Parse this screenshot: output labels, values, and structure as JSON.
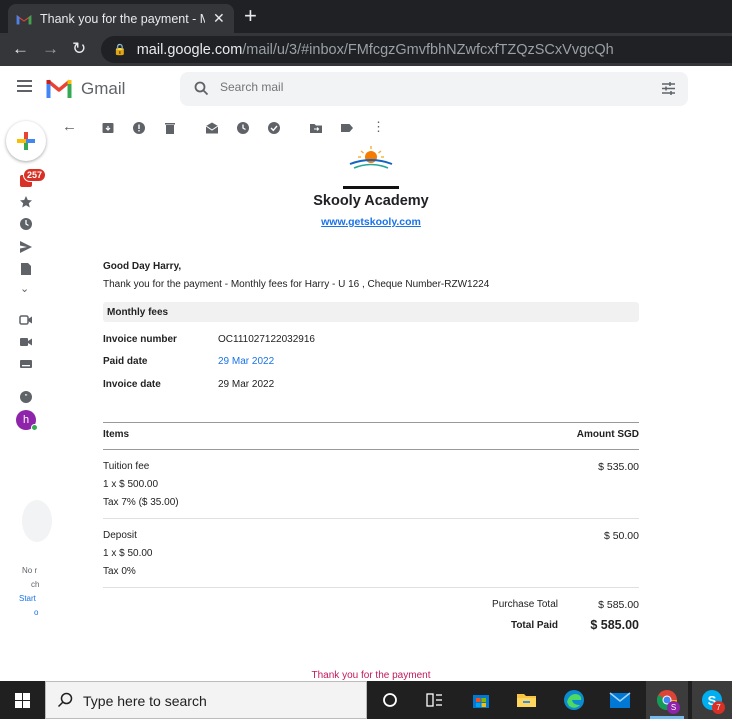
{
  "browser": {
    "tab_title": "Thank you for the payment - Mo",
    "url_host": "mail.google.com",
    "url_path": "/mail/u/3/#inbox/FMfcgzGmvfbhNZwfcxfTZQzSCxVvgcQh"
  },
  "gmail": {
    "brand": "Gmail",
    "search_placeholder": "Search mail",
    "unread_count": "257",
    "avatar_initial": "h",
    "side_text": [
      "No r",
      "ch",
      "Start",
      "o"
    ]
  },
  "email": {
    "company": "Skooly Academy",
    "website": "www.getskooly.com",
    "greeting": "Good Day Harry,",
    "message": "Thank you for the payment - Monthly fees for Harry - U 16 , Cheque Number-RZW1224",
    "section": "Monthly fees",
    "fields": [
      {
        "label": "Invoice number",
        "value": "OC111027122032916"
      },
      {
        "label": "Paid date",
        "value": "29 Mar 2022"
      },
      {
        "label": "Invoice date",
        "value": "29 Mar 2022"
      }
    ],
    "items_header": "Items",
    "amount_header": "Amount SGD",
    "items": [
      {
        "name": "Tuition fee",
        "qty": "1 x $ 500.00",
        "tax": "Tax 7% ($ 35.00)",
        "amount": "$ 535.00"
      },
      {
        "name": "Deposit",
        "qty": "1 x $ 50.00",
        "tax": "Tax 0%",
        "amount": "$ 50.00"
      }
    ],
    "purchase_total_label": "Purchase Total",
    "purchase_total": "$ 585.00",
    "total_paid_label": "Total Paid",
    "total_paid": "$ 585.00",
    "footer": "Thank you for the payment"
  },
  "taskbar": {
    "search_placeholder": "Type here to search",
    "chrome_badge": "S",
    "skype_badge": "7"
  },
  "colors": {
    "link_blue": "#1a73e8",
    "footer_red": "#c2185b",
    "badge_red": "#d93025"
  }
}
